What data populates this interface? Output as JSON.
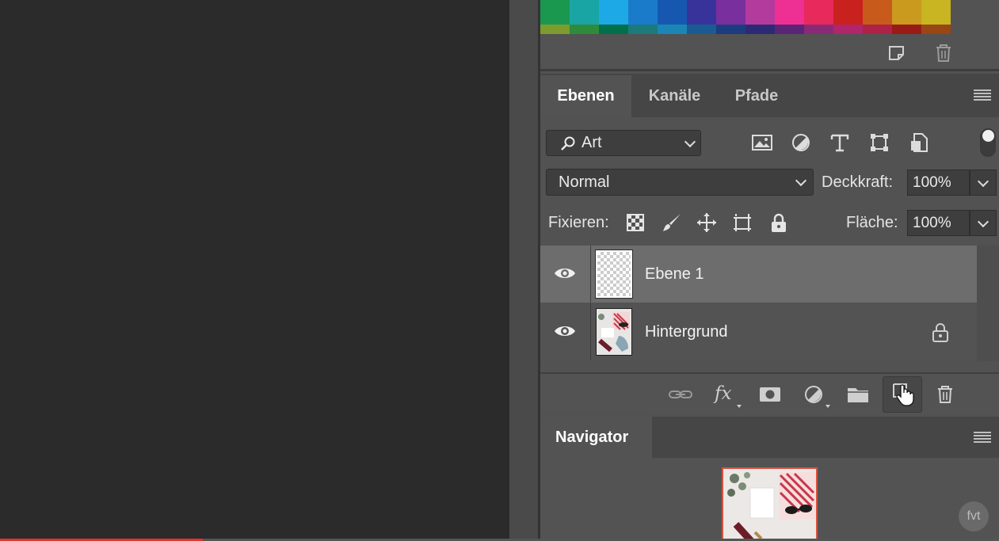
{
  "swatches": {
    "row1": [
      "#1a9850",
      "#1aa5a5",
      "#1da8e6",
      "#1a7bcb",
      "#1658b0",
      "#38339a",
      "#7a2f9e",
      "#b23b9d",
      "#ee2f93",
      "#e8295b",
      "#c9211e",
      "#c85a1c",
      "#c99a1e",
      "#c8b521"
    ],
    "row2": [
      "#7d9b2e",
      "#2e8b3c",
      "#00704a",
      "#1b7a7a",
      "#1a86b5",
      "#1b5b94",
      "#1c3c80",
      "#2d2a75",
      "#5a2577",
      "#8a2a77",
      "#b0256c",
      "#ad2246",
      "#9a1a16",
      "#9a4614"
    ],
    "icons": [
      "new-swatch-icon",
      "trash-icon"
    ]
  },
  "tabs": [
    {
      "label": "Ebenen",
      "active": true
    },
    {
      "label": "Kanäle",
      "active": false
    },
    {
      "label": "Pfade",
      "active": false
    }
  ],
  "filter": {
    "kind_label": "Art",
    "icons": [
      "image-filter-icon",
      "adjustment-filter-icon",
      "text-filter-icon",
      "shape-filter-icon",
      "smartobject-filter-icon"
    ]
  },
  "blend": {
    "mode": "Normal",
    "opacity_label": "Deckkraft:",
    "opacity_value": "100%"
  },
  "lock": {
    "label": "Fixieren:",
    "icons": [
      "lock-transparent-icon",
      "lock-brush-icon",
      "lock-position-icon",
      "lock-artboard-icon",
      "lock-all-icon"
    ],
    "fill_label": "Fläche:",
    "fill_value": "100%"
  },
  "layers": [
    {
      "name": "Ebene 1",
      "selected": true,
      "visible": true,
      "locked": false
    },
    {
      "name": "Hintergrund",
      "selected": false,
      "visible": true,
      "locked": true
    }
  ],
  "layer_toolbar": {
    "icons": [
      "link-layers-icon",
      "fx-icon",
      "mask-icon",
      "adjustment-layer-icon",
      "folder-icon",
      "new-layer-icon",
      "trash-icon"
    ],
    "fx_text": "fx"
  },
  "navigator": {
    "title": "Navigator"
  },
  "badge": "fvt",
  "colors": {
    "panel_bg": "#535353",
    "selected_row": "#6d6d6d",
    "accent_red": "#e1342a"
  }
}
